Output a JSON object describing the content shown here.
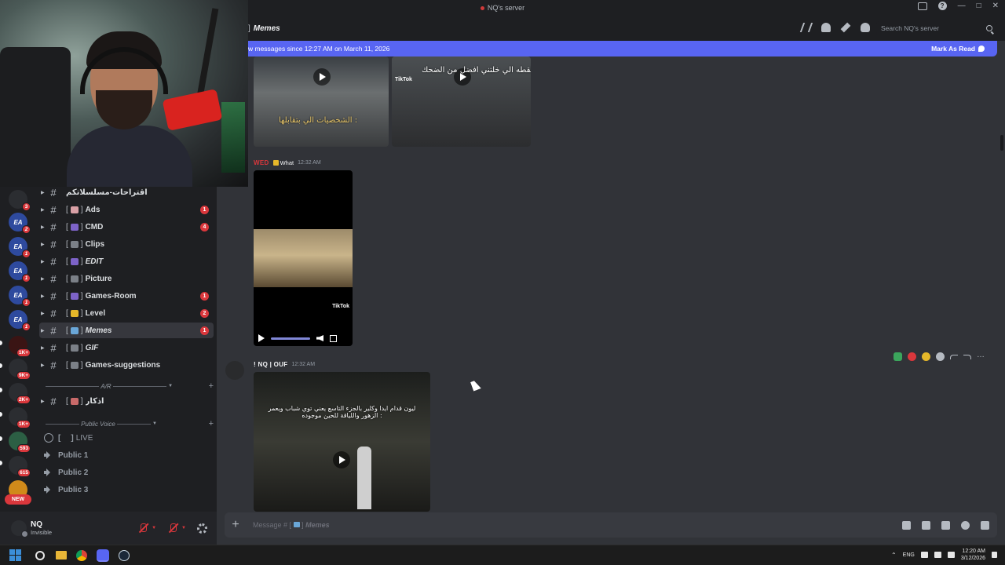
{
  "window": {
    "title": "NQ's server"
  },
  "header": {
    "channel_bracket": "]",
    "channel_name": "Memes",
    "search_placeholder": "Search NQ's server"
  },
  "new_messages_bar": {
    "text": "w messages since 12:27 AM on March 11, 2026",
    "action": "Mark As Read"
  },
  "servers": [
    {
      "badge": "3"
    },
    {
      "label": "EA",
      "badge": "2"
    },
    {
      "label": "EA",
      "badge": "1"
    },
    {
      "label": "EA",
      "badge": "1"
    },
    {
      "label": "EA",
      "badge": "1"
    },
    {
      "label": "EA",
      "badge": "1"
    },
    {
      "badge": "1K+"
    },
    {
      "badge": "9K+"
    },
    {
      "badge": "2K+"
    },
    {
      "badge": "1K+"
    },
    {
      "badge": "593"
    },
    {
      "badge": "615"
    }
  ],
  "new_label": "NEW",
  "channels": [
    {
      "name": "اقتراحات-مسلسلاتكم",
      "bracket": "",
      "mention": ""
    },
    {
      "name": "Ads",
      "bracket": "[",
      "close": "]",
      "mention": "1"
    },
    {
      "name": "CMD",
      "bracket": "[",
      "close": "]",
      "mention": "4"
    },
    {
      "name": "Clips",
      "bracket": "[",
      "close": "]",
      "mention": ""
    },
    {
      "name": "EDIT",
      "bracket": "[",
      "close": "]",
      "mention": ""
    },
    {
      "name": "Picture",
      "bracket": "[",
      "close": "]",
      "mention": ""
    },
    {
      "name": "Games-Room",
      "bracket": "[",
      "close": "]",
      "mention": "1"
    },
    {
      "name": "Level",
      "bracket": "[",
      "close": "]",
      "mention": "2"
    },
    {
      "name": "Memes",
      "bracket": "[",
      "close": "]",
      "mention": "1"
    },
    {
      "name": "GIF",
      "bracket": "[",
      "close": "]",
      "mention": ""
    },
    {
      "name": "Games-suggestions",
      "bracket": "[",
      "close": "]",
      "mention": ""
    }
  ],
  "category_ajr": "A/R",
  "channel_azkar": {
    "name": "اذكار",
    "bracket": "[",
    "close": "]"
  },
  "category_voice": "Public Voice",
  "voice": [
    {
      "name": "LIVE",
      "bracket": "[",
      "close": "]"
    },
    {
      "name": "Public 1"
    },
    {
      "name": "Public 2"
    },
    {
      "name": "Public 3"
    }
  ],
  "user": {
    "name": "NQ",
    "status": "Invisible"
  },
  "messages": {
    "top_caption_left": "الشخصيات الي بتقابلها :",
    "top_caption_right": "اللقطه الي خلتني افضل من الضحك",
    "tiktok_label": "TikTok",
    "msg1": {
      "author": "WED",
      "role": "What",
      "time": "12:32 AM"
    },
    "msg2": {
      "author": "! NQ | OUF",
      "time": "12:32 AM",
      "caption": "ليون قدام ايدا وكلير بالجزء التاسع يعني توي شباب ويعمر الزهور واللياقة للحين موجوده :"
    }
  },
  "composer": {
    "placeholder_prefix": "Message #",
    "placeholder_channel": "Memes"
  },
  "taskbar": {
    "lang": "ENG",
    "time": "12:20 AM",
    "date": "3/12/2026"
  }
}
